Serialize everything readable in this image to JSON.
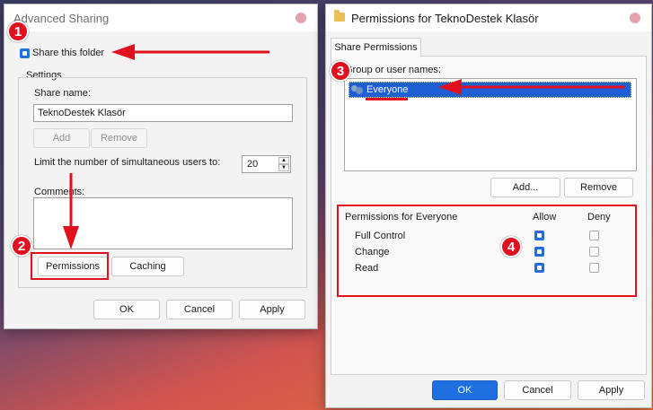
{
  "advanced": {
    "title": "Advanced Sharing",
    "share_checkbox_label": "Share this folder",
    "settings_label": "Settings",
    "share_name_label": "Share name:",
    "share_name_value": "TeknoDestek Klasör",
    "add_label": "Add",
    "remove_label": "Remove",
    "limit_label": "Limit the number of simultaneous users to:",
    "limit_value": "20",
    "comments_label": "Comments:",
    "permissions_label": "Permissions",
    "caching_label": "Caching",
    "ok_label": "OK",
    "cancel_label": "Cancel",
    "apply_label": "Apply"
  },
  "permissions": {
    "title": "Permissions for TeknoDestek Klasör",
    "tab_label": "Share Permissions",
    "group_label": "Group or user names:",
    "users": [
      "Everyone"
    ],
    "add_label": "Add...",
    "remove_label": "Remove",
    "perm_for_label": "Permissions for Everyone",
    "allow_label": "Allow",
    "deny_label": "Deny",
    "rows": [
      {
        "name": "Full Control",
        "allow": true,
        "deny": false
      },
      {
        "name": "Change",
        "allow": true,
        "deny": false
      },
      {
        "name": "Read",
        "allow": true,
        "deny": false
      }
    ],
    "ok_label": "OK",
    "cancel_label": "Cancel",
    "apply_label": "Apply"
  },
  "annotations": {
    "step1": "1",
    "step2": "2",
    "step3": "3",
    "step4": "4",
    "color": "#e0101e"
  }
}
